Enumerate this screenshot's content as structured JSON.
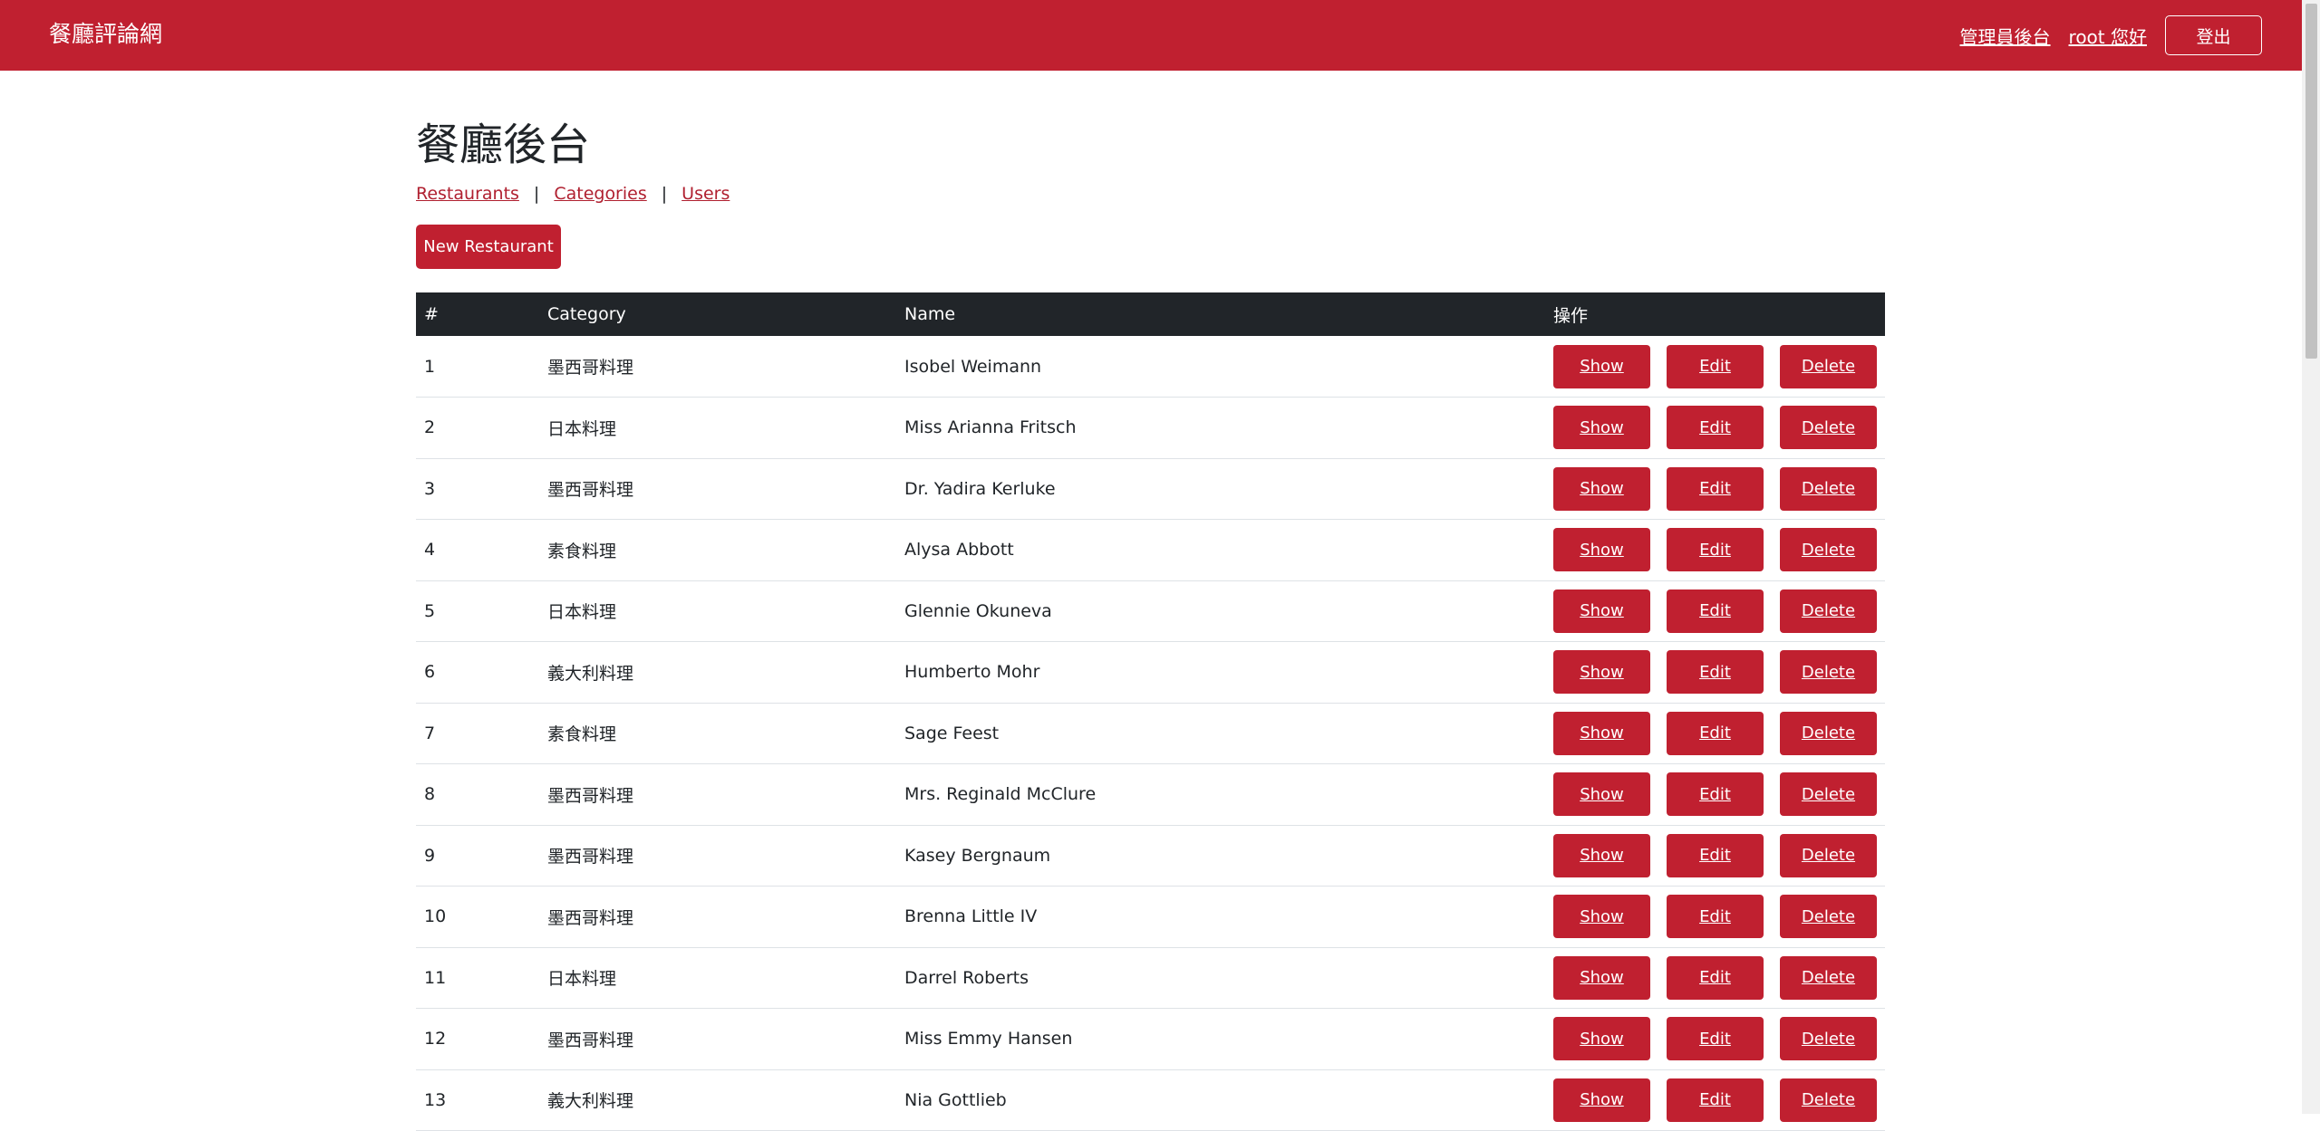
{
  "navbar": {
    "brand": "餐廳評論網",
    "admin_link": "管理員後台",
    "greeting": "root 您好",
    "logout": "登出"
  },
  "page": {
    "title": "餐廳後台",
    "subnav": [
      "Restaurants",
      "Categories",
      "Users"
    ],
    "subnav_separator": "|",
    "new_button": "New Restaurant"
  },
  "table": {
    "headers": [
      "#",
      "Category",
      "Name",
      "操作"
    ],
    "action_labels": {
      "show": "Show",
      "edit": "Edit",
      "delete": "Delete"
    },
    "rows": [
      {
        "id": "1",
        "category": "墨西哥料理",
        "name": "Isobel Weimann"
      },
      {
        "id": "2",
        "category": "日本料理",
        "name": "Miss Arianna Fritsch"
      },
      {
        "id": "3",
        "category": "墨西哥料理",
        "name": "Dr. Yadira Kerluke"
      },
      {
        "id": "4",
        "category": "素食料理",
        "name": "Alysa Abbott"
      },
      {
        "id": "5",
        "category": "日本料理",
        "name": "Glennie Okuneva"
      },
      {
        "id": "6",
        "category": "義大利料理",
        "name": "Humberto Mohr"
      },
      {
        "id": "7",
        "category": "素食料理",
        "name": "Sage Feest"
      },
      {
        "id": "8",
        "category": "墨西哥料理",
        "name": "Mrs. Reginald McClure"
      },
      {
        "id": "9",
        "category": "墨西哥料理",
        "name": "Kasey Bergnaum"
      },
      {
        "id": "10",
        "category": "墨西哥料理",
        "name": "Brenna Little IV"
      },
      {
        "id": "11",
        "category": "日本料理",
        "name": "Darrel Roberts"
      },
      {
        "id": "12",
        "category": "墨西哥料理",
        "name": "Miss Emmy Hansen"
      },
      {
        "id": "13",
        "category": "義大利料理",
        "name": "Nia Gottlieb"
      }
    ]
  },
  "colors": {
    "brand_red": "#c02030",
    "header_dark": "#212529",
    "link_red": "#b02030"
  }
}
